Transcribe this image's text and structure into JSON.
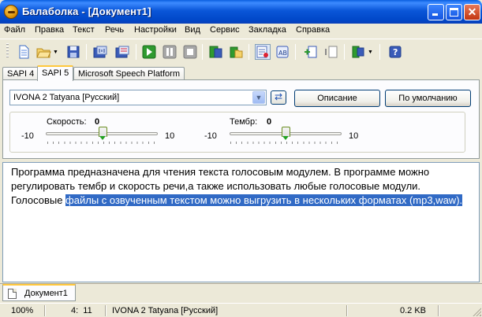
{
  "window": {
    "title": "Балаболка - [Документ1]"
  },
  "menu": [
    "Файл",
    "Правка",
    "Текст",
    "Речь",
    "Настройки",
    "Вид",
    "Сервис",
    "Закладка",
    "Справка"
  ],
  "tabs": [
    {
      "label": "SAPI 4",
      "active": false
    },
    {
      "label": "SAPI 5",
      "active": true
    },
    {
      "label": "Microsoft Speech Platform",
      "active": false
    }
  ],
  "voice": {
    "selected": "IVONA 2 Tatyana [Русский]",
    "describe_label": "Описание",
    "default_label": "По умолчанию"
  },
  "rate": {
    "label": "Скорость:",
    "value": "0",
    "min": "-10",
    "max": "10",
    "level": 0
  },
  "pitch": {
    "label": "Тембр:",
    "value": "0",
    "min": "-10",
    "max": "10",
    "level": 0
  },
  "editor": {
    "text_plain": "Программа предназначена для чтения текста голосовым модулем. В программе можно регулировать тембр и скорость речи,а также использовать любые голосовые модули. Голосовые ",
    "text_selected": "файлы с озвученным текстом можно выгрузить в нескольких форматах (mp3,waw)."
  },
  "document_tab": {
    "label": "Документ1"
  },
  "status": {
    "zoom": "100%",
    "position": "4:  11",
    "voice": "IVONA 2 Tatyana [Русский]",
    "size": "0.2 KB"
  },
  "colors": {
    "title_bar": "#0a56d8",
    "selection": "#316ac5",
    "tab_accent": "#ffc83c"
  }
}
